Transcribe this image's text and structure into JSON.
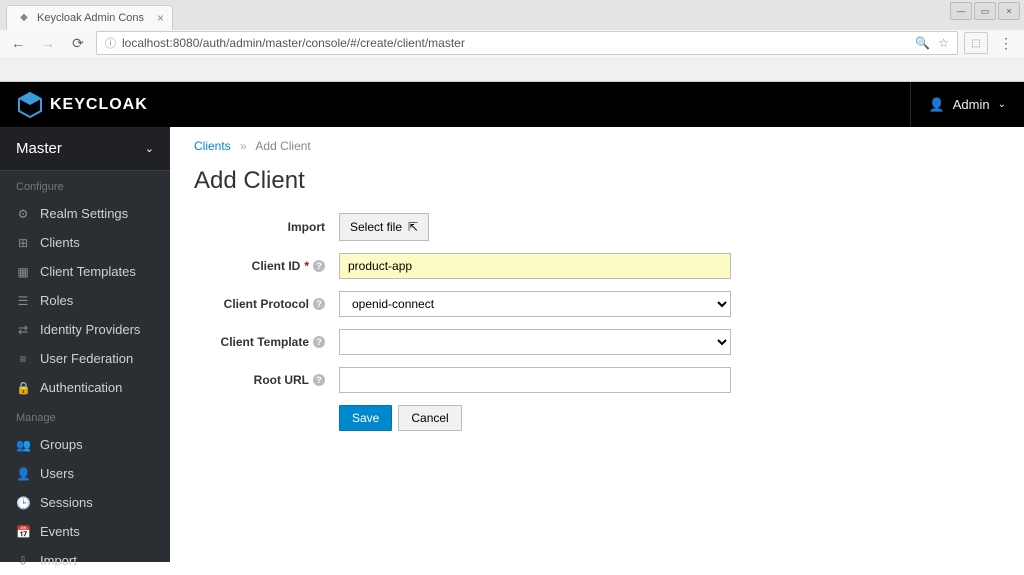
{
  "browser": {
    "tab_title": "Keycloak Admin Cons",
    "url": "localhost:8080/auth/admin/master/console/#/create/client/master"
  },
  "header": {
    "logo_text": "KEYCLOAK",
    "user": "Admin"
  },
  "sidebar": {
    "realm": "Master",
    "configure_label": "Configure",
    "manage_label": "Manage",
    "configure_items": [
      {
        "label": "Realm Settings",
        "icon": "⚙"
      },
      {
        "label": "Clients",
        "icon": "⊞"
      },
      {
        "label": "Client Templates",
        "icon": "▦"
      },
      {
        "label": "Roles",
        "icon": "☰"
      },
      {
        "label": "Identity Providers",
        "icon": "⇄"
      },
      {
        "label": "User Federation",
        "icon": "≡"
      },
      {
        "label": "Authentication",
        "icon": "🔒"
      }
    ],
    "manage_items": [
      {
        "label": "Groups",
        "icon": "👥"
      },
      {
        "label": "Users",
        "icon": "👤"
      },
      {
        "label": "Sessions",
        "icon": "🕒"
      },
      {
        "label": "Events",
        "icon": "📅"
      },
      {
        "label": "Import",
        "icon": "⇩"
      }
    ]
  },
  "breadcrumb": {
    "parent": "Clients",
    "current": "Add Client"
  },
  "page": {
    "title": "Add Client",
    "labels": {
      "import": "Import",
      "client_id": "Client ID",
      "client_protocol": "Client Protocol",
      "client_template": "Client Template",
      "root_url": "Root URL"
    },
    "select_file": "Select file",
    "client_id_value": "product-app",
    "client_protocol_value": "openid-connect",
    "client_template_value": "",
    "root_url_value": "",
    "save": "Save",
    "cancel": "Cancel"
  }
}
